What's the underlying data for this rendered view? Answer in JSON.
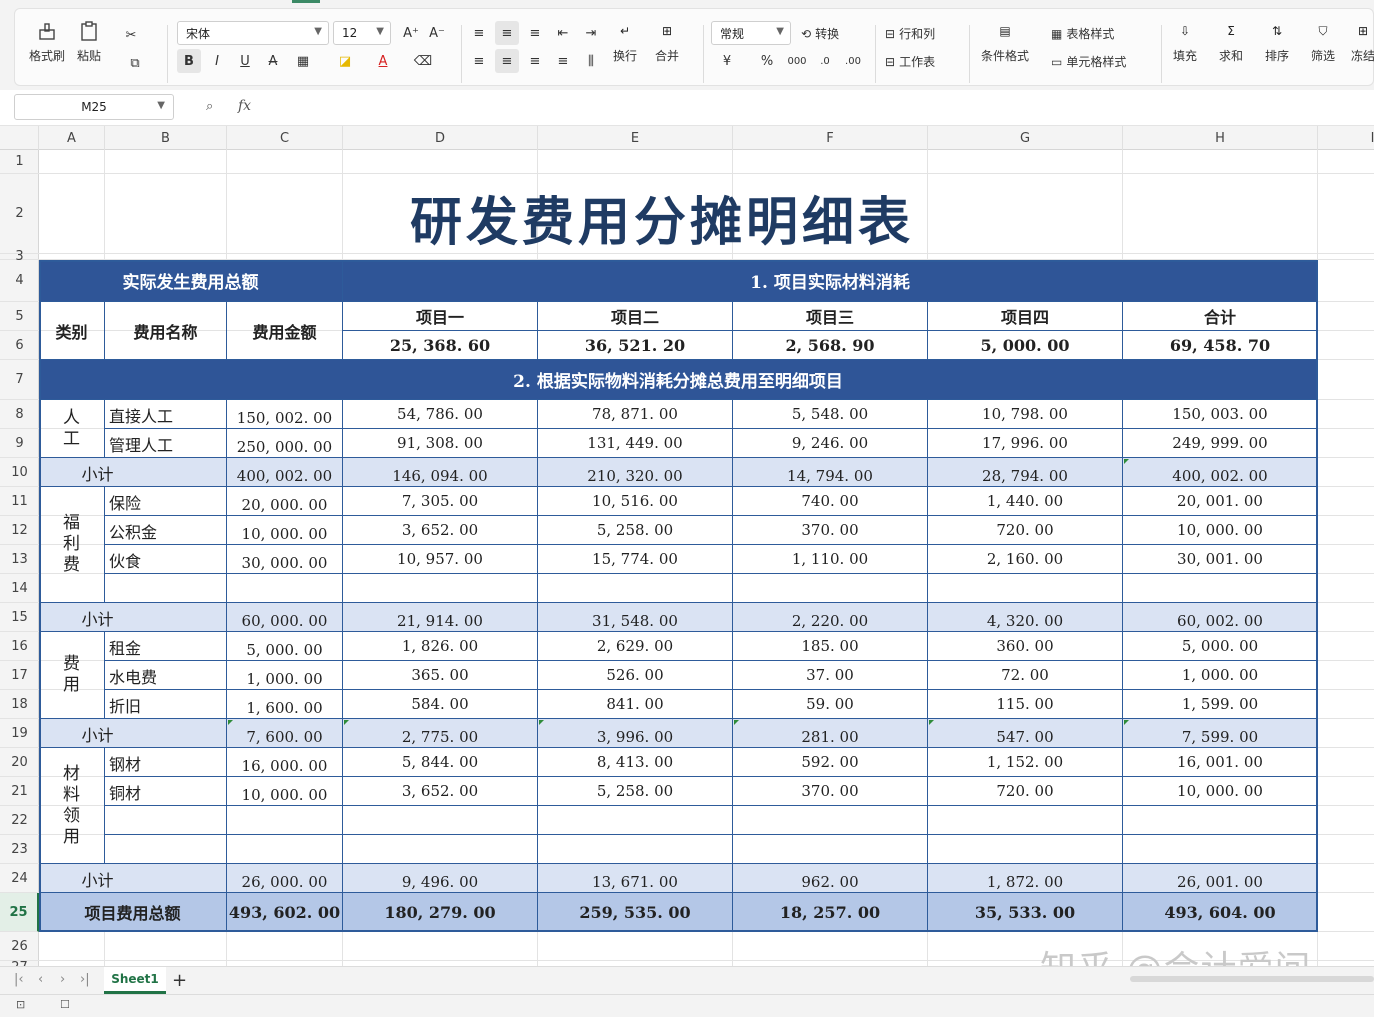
{
  "ribbon": {
    "format_painter": "格式刷",
    "paste": "粘贴",
    "font_name": "宋体",
    "font_size": "12",
    "wrap": "换行",
    "merge": "合并",
    "number_format": "常规",
    "convert": "转换",
    "rows_cols": "行和列",
    "worksheet": "工作表",
    "cond_format": "条件格式",
    "table_style": "表格样式",
    "cell_style": "单元格样式",
    "fill": "填充",
    "sum": "求和",
    "sort": "排序",
    "filter": "筛选",
    "freeze": "冻结",
    "bold": "B",
    "italic": "I",
    "underline": "U",
    "strike": "A",
    "font_grow": "A⁺",
    "font_shrink": "A⁻",
    "font_color": "A",
    "currency": "¥",
    "percent": "%"
  },
  "formula_bar": {
    "name_box": "M25",
    "fx": "fx",
    "formula": ""
  },
  "columns": [
    "A",
    "B",
    "C",
    "D",
    "E",
    "F",
    "G",
    "H",
    "I"
  ],
  "rows": [
    "1",
    "2",
    "3",
    "4",
    "5",
    "6",
    "7",
    "8",
    "9",
    "10",
    "11",
    "12",
    "13",
    "14",
    "15",
    "16",
    "17",
    "18",
    "19",
    "20",
    "21",
    "22",
    "23",
    "24",
    "25",
    "26",
    "27"
  ],
  "selected_row": "25",
  "title": "研发费用分摊明细表",
  "table": {
    "left_header": "实际发生费用总额",
    "right_header": "1. 项目实际材料消耗",
    "col_category": "类别",
    "col_name": "费用名称",
    "col_amount": "费用金额",
    "projects": [
      "项目一",
      "项目二",
      "项目三",
      "项目四",
      "合计"
    ],
    "material": [
      "25, 368. 60",
      "36, 521. 20",
      "2, 568. 90",
      "5, 000. 00",
      "69, 458. 70"
    ],
    "section2": "2. 根据实际物料消耗分摊总费用至明细项目",
    "subtotal_label": "小计",
    "groups": [
      {
        "category": "人工",
        "items": [
          {
            "name": "直接人工",
            "amount": "150, 002. 00",
            "vals": [
              "54, 786. 00",
              "78, 871. 00",
              "5, 548. 00",
              "10, 798. 00",
              "150, 003. 00"
            ]
          },
          {
            "name": "管理人工",
            "amount": "250, 000. 00",
            "vals": [
              "91, 308. 00",
              "131, 449. 00",
              "9, 246. 00",
              "17, 996. 00",
              "249, 999. 00"
            ]
          }
        ],
        "subtotal": {
          "amount": "400, 002. 00",
          "vals": [
            "146, 094. 00",
            "210, 320. 00",
            "14, 794. 00",
            "28, 794. 00",
            "400, 002. 00"
          ]
        }
      },
      {
        "category": "福利费",
        "items": [
          {
            "name": "保险",
            "amount": "20, 000. 00",
            "vals": [
              "7, 305. 00",
              "10, 516. 00",
              "740. 00",
              "1, 440. 00",
              "20, 001. 00"
            ]
          },
          {
            "name": "公积金",
            "amount": "10, 000. 00",
            "vals": [
              "3, 652. 00",
              "5, 258. 00",
              "370. 00",
              "720. 00",
              "10, 000. 00"
            ]
          },
          {
            "name": "伙食",
            "amount": "30, 000. 00",
            "vals": [
              "10, 957. 00",
              "15, 774. 00",
              "1, 110. 00",
              "2, 160. 00",
              "30, 001. 00"
            ]
          },
          {
            "name": "",
            "amount": "",
            "vals": [
              "",
              "",
              "",
              "",
              ""
            ]
          }
        ],
        "subtotal": {
          "amount": "60, 000. 00",
          "vals": [
            "21, 914. 00",
            "31, 548. 00",
            "2, 220. 00",
            "4, 320. 00",
            "60, 002. 00"
          ]
        }
      },
      {
        "category": "费用",
        "items": [
          {
            "name": "租金",
            "amount": "5, 000. 00",
            "vals": [
              "1, 826. 00",
              "2, 629. 00",
              "185. 00",
              "360. 00",
              "5, 000. 00"
            ]
          },
          {
            "name": "水电费",
            "amount": "1, 000. 00",
            "vals": [
              "365. 00",
              "526. 00",
              "37. 00",
              "72. 00",
              "1, 000. 00"
            ]
          },
          {
            "name": "折旧",
            "amount": "1, 600. 00",
            "vals": [
              "584. 00",
              "841. 00",
              "59. 00",
              "115. 00",
              "1, 599. 00"
            ]
          }
        ],
        "subtotal": {
          "amount": "7, 600. 00",
          "vals": [
            "2, 775. 00",
            "3, 996. 00",
            "281. 00",
            "547. 00",
            "7, 599. 00"
          ]
        }
      },
      {
        "category": "材料领用",
        "items": [
          {
            "name": "钢材",
            "amount": "16, 000. 00",
            "vals": [
              "5, 844. 00",
              "8, 413. 00",
              "592. 00",
              "1, 152. 00",
              "16, 001. 00"
            ]
          },
          {
            "name": "铜材",
            "amount": "10, 000. 00",
            "vals": [
              "3, 652. 00",
              "5, 258. 00",
              "370. 00",
              "720. 00",
              "10, 000. 00"
            ]
          },
          {
            "name": "",
            "amount": "",
            "vals": [
              "",
              "",
              "",
              "",
              ""
            ]
          },
          {
            "name": "",
            "amount": "",
            "vals": [
              "",
              "",
              "",
              "",
              ""
            ]
          }
        ],
        "subtotal": {
          "amount": "26, 000. 00",
          "vals": [
            "9, 496. 00",
            "13, 671. 00",
            "962. 00",
            "1, 872. 00",
            "26, 001. 00"
          ]
        }
      }
    ],
    "grand_total_label": "项目费用总额",
    "grand_total": {
      "amount": "493, 602. 00",
      "vals": [
        "180, 279. 00",
        "259, 535. 00",
        "18, 257. 00",
        "35, 533. 00",
        "493, 604. 00"
      ]
    }
  },
  "sheet_tabs": {
    "active": "Sheet1",
    "add": "+"
  },
  "watermark": "知乎 @会计爱问",
  "colors": {
    "header_blue": "#2f5597",
    "subtotal": "#dae3f3",
    "total": "#b4c7e7",
    "title": "#1f3b63",
    "accent_green": "#217346"
  }
}
